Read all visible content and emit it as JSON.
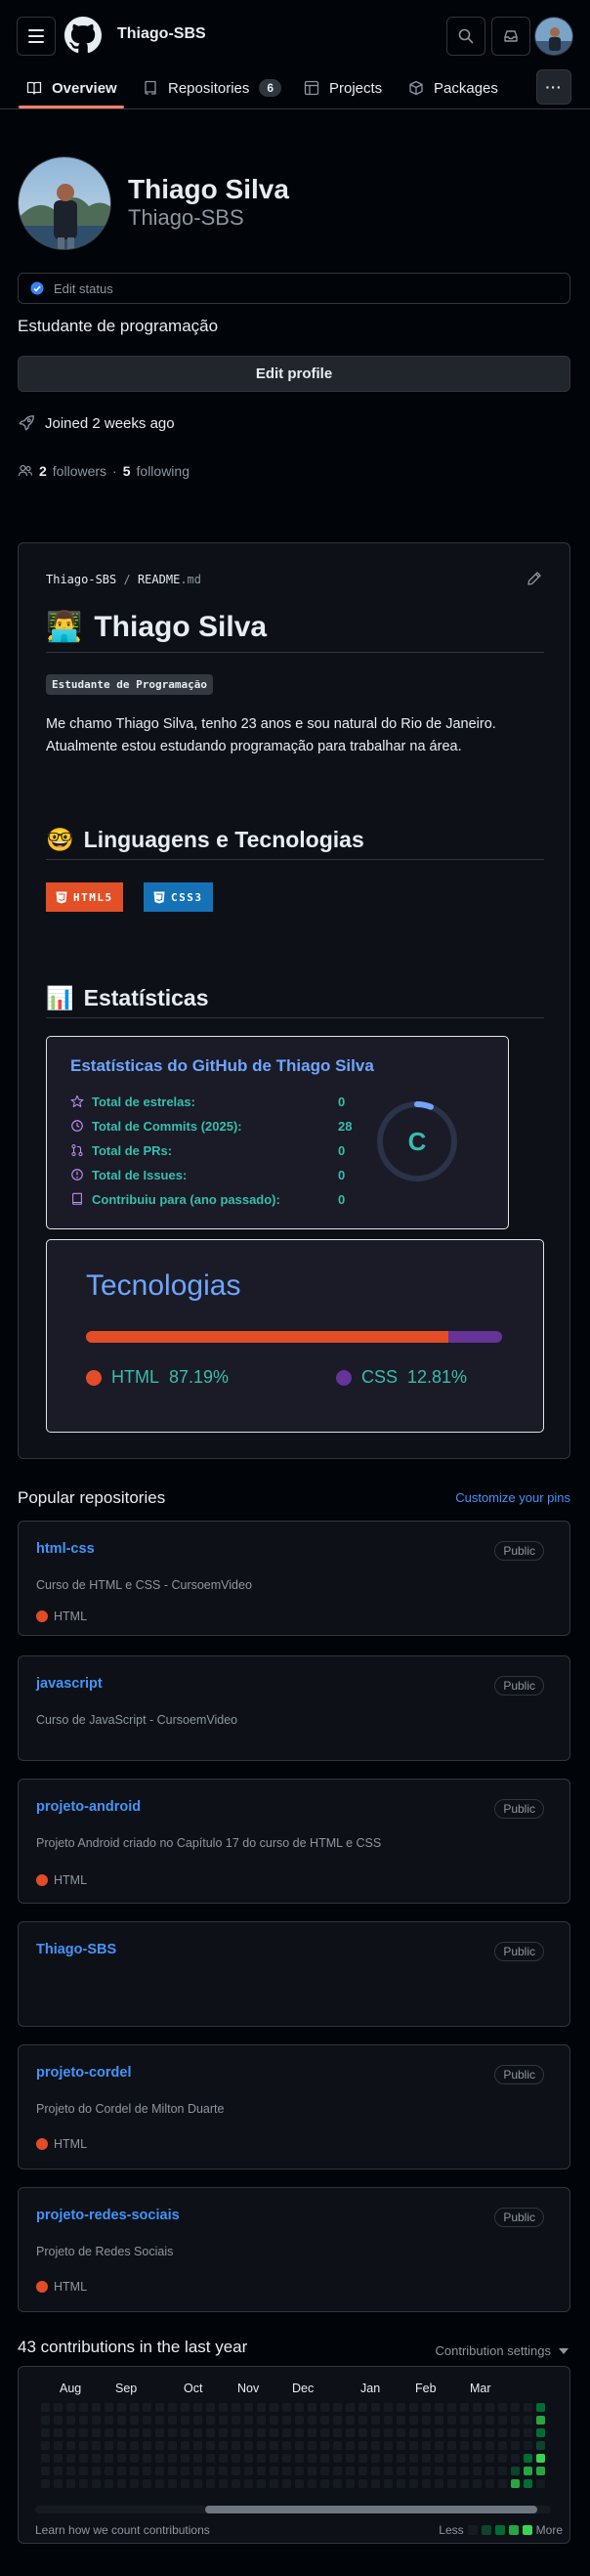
{
  "header": {
    "username": "Thiago-SBS"
  },
  "tabs": [
    {
      "label": "Overview"
    },
    {
      "label": "Repositories",
      "count": "6"
    },
    {
      "label": "Projects"
    },
    {
      "label": "Packages"
    }
  ],
  "more_label": "···",
  "profile": {
    "full_name": "Thiago Silva",
    "login": "Thiago-SBS",
    "status_label": "Edit status",
    "bio": "Estudante de programação",
    "edit_profile_label": "Edit profile",
    "joined": "Joined 2 weeks ago",
    "followers_count": "2",
    "followers_label": "followers",
    "separator": "·",
    "following_count": "5",
    "following_label": "following"
  },
  "readme": {
    "path_user": "Thiago-SBS",
    "path_sep": "/",
    "path_file": "README",
    "path_ext": ".md",
    "title_emoji": "👨‍💻",
    "title": "Thiago Silva",
    "code_badge": "Estudante de Programação",
    "paragraph": "Me chamo Thiago Silva, tenho 23 anos e sou natural do Rio de Janeiro. Atualmente estou estudando programação para trabalhar na área.",
    "lang_heading_emoji": "🤓",
    "lang_heading": "Linguagens e Tecnologias",
    "badges": [
      {
        "label": "HTML5",
        "color": "#e34f26"
      },
      {
        "label": "CSS3",
        "color": "#1572b6"
      }
    ],
    "stats_heading_emoji": "📊",
    "stats_heading": "Estatísticas",
    "stats_card": {
      "title": "Estatísticas do GitHub de Thiago Silva",
      "rows": [
        {
          "label": "Total de estrelas:",
          "value": "0",
          "icon": "star-icon"
        },
        {
          "label": "Total de Commits (2025):",
          "value": "28",
          "icon": "history-icon"
        },
        {
          "label": "Total de PRs:",
          "value": "0",
          "icon": "pull-request-icon"
        },
        {
          "label": "Total de Issues:",
          "value": "0",
          "icon": "issue-icon"
        },
        {
          "label": "Contribuiu para (ano passado):",
          "value": "0",
          "icon": "repo-icon"
        }
      ],
      "rank": "C",
      "rank_progress": 0.06
    },
    "lang_card": {
      "title": "Tecnologias",
      "items": [
        {
          "name": "HTML",
          "percent_label": "87.19%",
          "percent": 87.19,
          "color": "#e34c26"
        },
        {
          "name": "CSS",
          "percent_label": "12.81%",
          "percent": 12.81,
          "color": "#663399"
        }
      ]
    }
  },
  "popular": {
    "title": "Popular repositories",
    "customize": "Customize your pins",
    "repos": [
      {
        "name": "html-css",
        "visibility": "Public",
        "description": "Curso de HTML e CSS - CursoemVideo",
        "language": "HTML"
      },
      {
        "name": "javascript",
        "visibility": "Public",
        "description": "Curso de JavaScript - CursoemVideo",
        "language": ""
      },
      {
        "name": "projeto-android",
        "visibility": "Public",
        "description": "Projeto Android criado no Capítulo 17 do curso de HTML e CSS",
        "language": "HTML"
      },
      {
        "name": "Thiago-SBS",
        "visibility": "Public",
        "description": "",
        "language": ""
      },
      {
        "name": "projeto-cordel",
        "visibility": "Public",
        "description": "Projeto do Cordel de Milton Duarte",
        "language": "HTML"
      },
      {
        "name": "projeto-redes-sociais",
        "visibility": "Public",
        "description": "Projeto de Redes Sociais",
        "language": "HTML"
      }
    ]
  },
  "contributions": {
    "title": "43 contributions in the last year",
    "settings": "Contribution settings",
    "months": [
      "Aug",
      "Sep",
      "Oct",
      "Nov",
      "Dec",
      "Jan",
      "Feb",
      "Mar"
    ],
    "learn": "Learn how we count contributions",
    "less": "Less",
    "more": "More",
    "level_colors": [
      "#161b22",
      "#0e4429",
      "#006d32",
      "#26a641",
      "#39d353"
    ],
    "active_cells": [
      {
        "week": 52,
        "day": 0,
        "level": 2
      },
      {
        "week": 52,
        "day": 1,
        "level": 3
      },
      {
        "week": 52,
        "day": 2,
        "level": 2
      },
      {
        "week": 52,
        "day": 3,
        "level": 1
      },
      {
        "week": 51,
        "day": 4,
        "level": 2
      },
      {
        "week": 52,
        "day": 4,
        "level": 4
      },
      {
        "week": 51,
        "day": 5,
        "level": 3
      },
      {
        "week": 52,
        "day": 5,
        "level": 3
      },
      {
        "week": 50,
        "day": 5,
        "level": 1
      },
      {
        "week": 50,
        "day": 6,
        "level": 3
      },
      {
        "week": 51,
        "day": 6,
        "level": 2
      }
    ]
  }
}
